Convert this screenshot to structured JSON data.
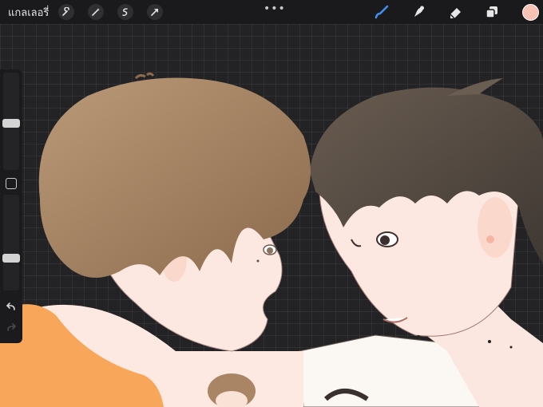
{
  "topbar": {
    "gallery_label": "แกลเลอรี่",
    "more_label": "•••",
    "tools_left": [
      "wrench-icon",
      "magic-wand-icon",
      "selection-icon",
      "transform-arrow-icon"
    ],
    "tools_right": [
      "brush-icon",
      "smudge-icon",
      "eraser-icon",
      "layers-icon"
    ],
    "active_tool": "brush-icon",
    "current_color": "#f7c2b4",
    "active_color": "#3f8ef0"
  },
  "sidebar": {
    "size_slider_level": 0.48,
    "opacity_slider_level": 0.32,
    "buttons": [
      "modify-button",
      "undo-button",
      "redo-button"
    ]
  }
}
